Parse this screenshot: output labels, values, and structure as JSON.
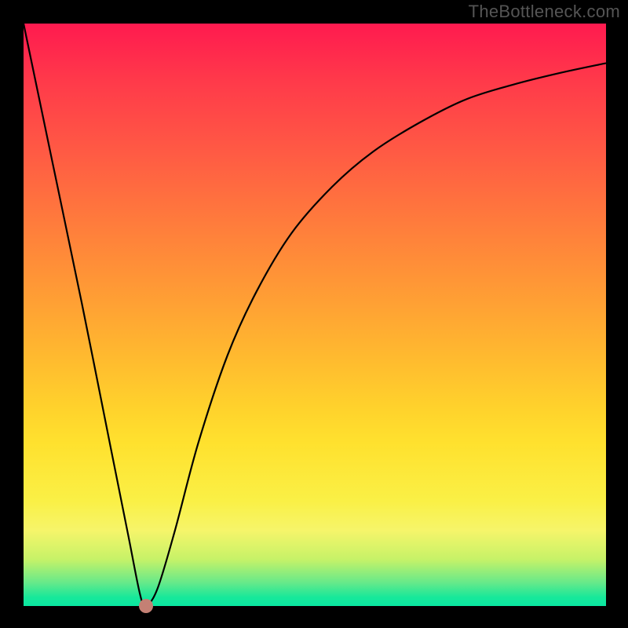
{
  "watermark": "TheBottleneck.com",
  "chart_data": {
    "type": "line",
    "title": "",
    "xlabel": "",
    "ylabel": "",
    "ylim": [
      0,
      100
    ],
    "xlim": [
      0,
      100
    ],
    "marker": {
      "x": 21,
      "y": 0,
      "color": "#c48074"
    },
    "gradient_stops": [
      {
        "pct": 0,
        "color": "#ff1a4f"
      },
      {
        "pct": 50,
        "color": "#ffb12f"
      },
      {
        "pct": 85,
        "color": "#f7f35a"
      },
      {
        "pct": 100,
        "color": "#0ae6a1"
      }
    ],
    "series": [
      {
        "name": "curve",
        "x": [
          0,
          5,
          10,
          15,
          18,
          20,
          21,
          23,
          26,
          30,
          35,
          40,
          46,
          53,
          60,
          68,
          76,
          84,
          92,
          100
        ],
        "y": [
          100,
          76,
          52,
          27,
          12,
          2,
          0,
          3,
          13,
          28,
          43,
          54,
          64,
          72,
          78,
          83,
          87,
          89.5,
          91.5,
          93.2
        ]
      }
    ],
    "curve_style": {
      "stroke": "#000000",
      "stroke_width": 2.2
    }
  }
}
